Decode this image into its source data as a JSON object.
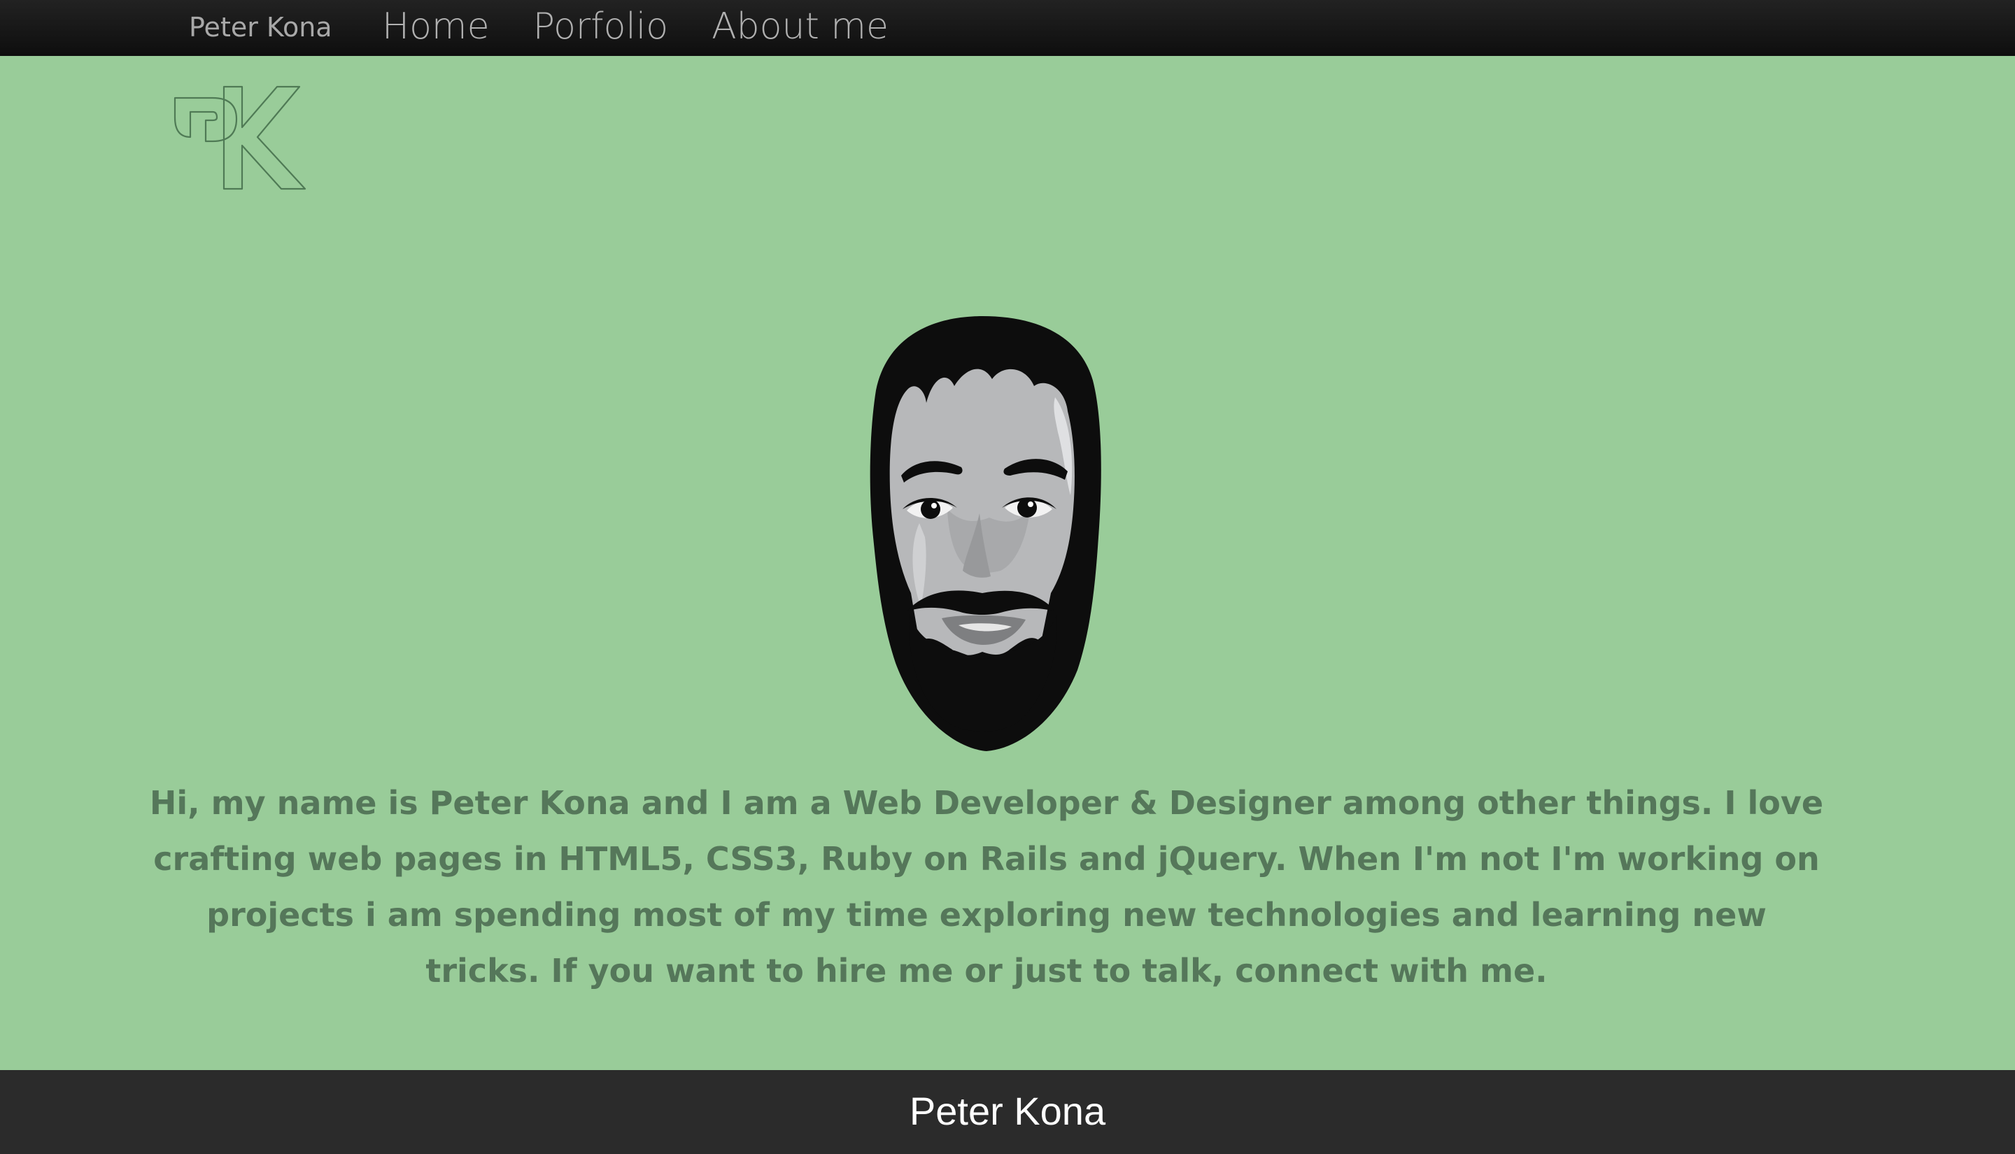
{
  "nav": {
    "brand": "Peter Kona",
    "links": [
      {
        "label": "Home"
      },
      {
        "label": "Porfolio"
      },
      {
        "label": "About me"
      }
    ]
  },
  "logo": {
    "text": "PK",
    "icon": "pk-monogram-logo"
  },
  "portrait": {
    "icon": "avatar-illustration"
  },
  "intro": {
    "text": "Hi, my name is Peter Kona and I am a Web Developer & Designer among other things. I love crafting web pages in HTML5, CSS3, Ruby on Rails and jQuery. When I'm not I'm working on projects i am spending most of my time exploring new technologies and learning new tricks. If you want to hire me or just to talk, connect with me."
  },
  "footer": {
    "name": "Peter Kona"
  },
  "colors": {
    "background": "#99cc99",
    "navbar": "#111111",
    "footer": "#2b2b2b",
    "intro_text": "#55775a"
  }
}
